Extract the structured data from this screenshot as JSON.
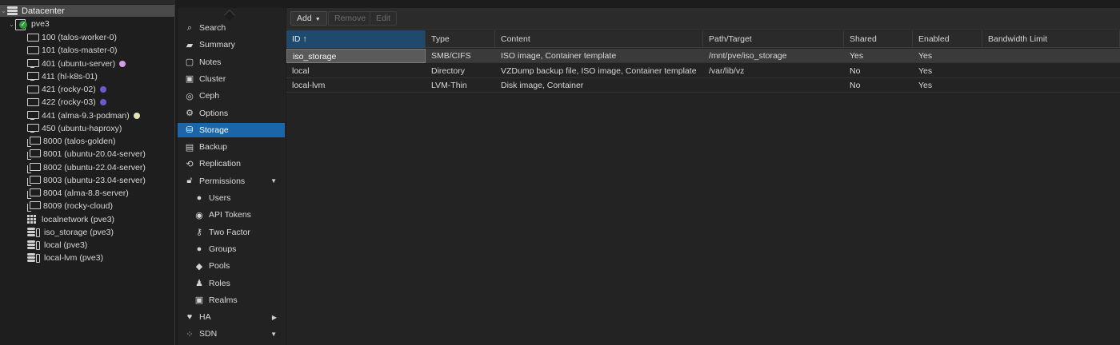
{
  "tree": {
    "datacenter": "Datacenter",
    "node": "pve3",
    "items": [
      {
        "label": "100 (talos-worker-0)",
        "type": "vm",
        "icon": "monitor-icon",
        "tag_color": ""
      },
      {
        "label": "101 (talos-master-0)",
        "type": "vm",
        "icon": "monitor-icon",
        "tag_color": ""
      },
      {
        "label": "401 (ubuntu-server)",
        "type": "vm",
        "icon": "monitor-icon",
        "tag_color": "#d89be8"
      },
      {
        "label": "411 (hl-k8s-01)",
        "type": "vm",
        "icon": "monitor-icon",
        "tag_color": ""
      },
      {
        "label": "421 (rocky-02)",
        "type": "vm",
        "icon": "monitor-icon",
        "tag_color": "#6a5bd0"
      },
      {
        "label": "422 (rocky-03)",
        "type": "vm",
        "icon": "monitor-icon",
        "tag_color": "#6a5bd0"
      },
      {
        "label": "441 (alma-9.3-podman)",
        "type": "vm",
        "icon": "monitor-icon",
        "tag_color": "#e4e3b4"
      },
      {
        "label": "450 (ubuntu-haproxy)",
        "type": "vm",
        "icon": "monitor-icon",
        "tag_color": ""
      },
      {
        "label": "8000 (talos-golden)",
        "type": "template",
        "icon": "template-icon",
        "tag_color": ""
      },
      {
        "label": "8001 (ubuntu-20.04-server)",
        "type": "template",
        "icon": "template-icon",
        "tag_color": ""
      },
      {
        "label": "8002 (ubuntu-22.04-server)",
        "type": "template",
        "icon": "template-icon",
        "tag_color": ""
      },
      {
        "label": "8003 (ubuntu-23.04-server)",
        "type": "template",
        "icon": "template-icon",
        "tag_color": ""
      },
      {
        "label": "8004 (alma-8.8-server)",
        "type": "template",
        "icon": "template-icon",
        "tag_color": ""
      },
      {
        "label": "8009 (rocky-cloud)",
        "type": "template",
        "icon": "template-icon",
        "tag_color": ""
      },
      {
        "label": "localnetwork (pve3)",
        "type": "network",
        "icon": "network-grid-icon",
        "tag_color": ""
      },
      {
        "label": "iso_storage (pve3)",
        "type": "storage",
        "icon": "storage-icon",
        "tag_color": ""
      },
      {
        "label": "local (pve3)",
        "type": "storage",
        "icon": "storage-icon",
        "tag_color": ""
      },
      {
        "label": "local-lvm (pve3)",
        "type": "storage",
        "icon": "storage-icon",
        "tag_color": ""
      }
    ]
  },
  "menu": {
    "items": [
      {
        "label": "Search",
        "icon": "search-icon",
        "glyph": "⌕",
        "sub": false,
        "active": false,
        "arrow": ""
      },
      {
        "label": "Summary",
        "icon": "book-icon",
        "glyph": "▰",
        "sub": false,
        "active": false,
        "arrow": ""
      },
      {
        "label": "Notes",
        "icon": "notes-icon",
        "glyph": "▢",
        "sub": false,
        "active": false,
        "arrow": ""
      },
      {
        "label": "Cluster",
        "icon": "cluster-icon",
        "glyph": "▣",
        "sub": false,
        "active": false,
        "arrow": ""
      },
      {
        "label": "Ceph",
        "icon": "ceph-icon",
        "glyph": "◎",
        "sub": false,
        "active": false,
        "arrow": ""
      },
      {
        "label": "Options",
        "icon": "gear-icon",
        "glyph": "⚙",
        "sub": false,
        "active": false,
        "arrow": ""
      },
      {
        "label": "Storage",
        "icon": "database-icon",
        "glyph": "⛁",
        "sub": false,
        "active": true,
        "arrow": ""
      },
      {
        "label": "Backup",
        "icon": "backup-icon",
        "glyph": "▤",
        "sub": false,
        "active": false,
        "arrow": ""
      },
      {
        "label": "Replication",
        "icon": "replication-icon",
        "glyph": "⟲",
        "sub": false,
        "active": false,
        "arrow": ""
      },
      {
        "label": "Permissions",
        "icon": "unlock-icon",
        "glyph": "🔓︎",
        "sub": false,
        "active": false,
        "arrow": "▼"
      },
      {
        "label": "Users",
        "icon": "user-icon",
        "glyph": "●",
        "sub": true,
        "active": false,
        "arrow": ""
      },
      {
        "label": "API Tokens",
        "icon": "user-tag-icon",
        "glyph": "◉",
        "sub": true,
        "active": false,
        "arrow": ""
      },
      {
        "label": "Two Factor",
        "icon": "key-icon",
        "glyph": "⚷",
        "sub": true,
        "active": false,
        "arrow": ""
      },
      {
        "label": "Groups",
        "icon": "users-icon",
        "glyph": "●",
        "sub": true,
        "active": false,
        "arrow": ""
      },
      {
        "label": "Pools",
        "icon": "tags-icon",
        "glyph": "◆",
        "sub": true,
        "active": false,
        "arrow": ""
      },
      {
        "label": "Roles",
        "icon": "male-icon",
        "glyph": "♟",
        "sub": true,
        "active": false,
        "arrow": ""
      },
      {
        "label": "Realms",
        "icon": "address-book-icon",
        "glyph": "▣",
        "sub": true,
        "active": false,
        "arrow": ""
      },
      {
        "label": "HA",
        "icon": "heartbeat-icon",
        "glyph": "♥",
        "sub": false,
        "active": false,
        "arrow": "▶"
      },
      {
        "label": "SDN",
        "icon": "sdn-icon",
        "glyph": "⁘",
        "sub": false,
        "active": false,
        "arrow": "▼"
      }
    ]
  },
  "toolbar": {
    "add": "Add",
    "remove": "Remove",
    "edit": "Edit"
  },
  "grid": {
    "columns": [
      "ID ↑",
      "Type",
      "Content",
      "Path/Target",
      "Shared",
      "Enabled",
      "Bandwidth Limit"
    ],
    "rows": [
      [
        "iso_storage",
        "SMB/CIFS",
        "ISO image, Container template",
        "/mnt/pve/iso_storage",
        "Yes",
        "Yes",
        ""
      ],
      [
        "local",
        "Directory",
        "VZDump backup file, ISO image, Container template",
        "/var/lib/vz",
        "No",
        "Yes",
        ""
      ],
      [
        "local-lvm",
        "LVM-Thin",
        "Disk image, Container",
        "",
        "No",
        "Yes",
        ""
      ]
    ]
  },
  "colors": {
    "accent": "#1a66a8",
    "background": "#1c1c1c",
    "node_ok": "#2c9b3a"
  }
}
